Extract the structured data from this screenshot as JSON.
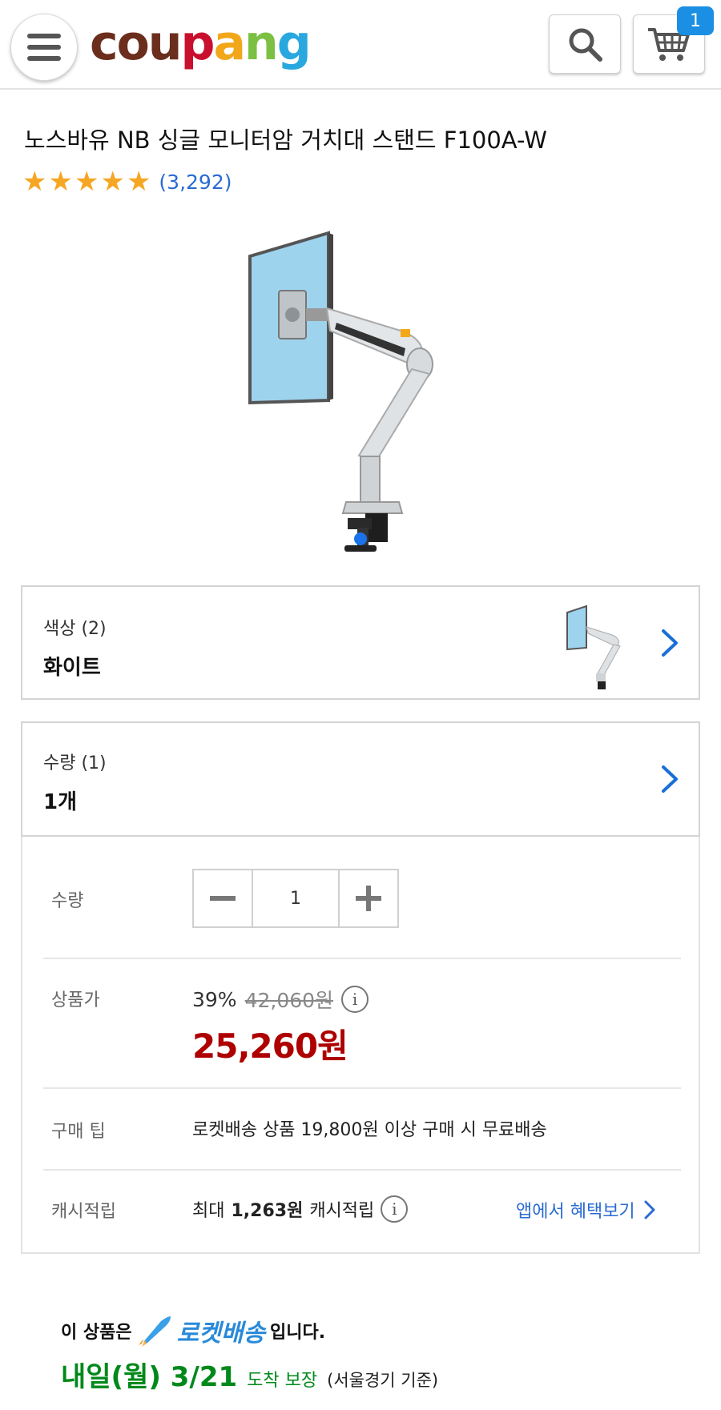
{
  "header": {
    "logo_text": [
      "cou",
      "p",
      "a",
      "n",
      "g"
    ],
    "cart_count": "1"
  },
  "product": {
    "title": "노스바유 NB 싱글 모니터암 거치대 스탠드 F100A-W",
    "rating_stars": 5,
    "review_count": "(3,292)"
  },
  "options": {
    "color_label": "색상 (2)",
    "color_value": "화이트",
    "qty_label": "수량 (1)",
    "qty_value": "1개"
  },
  "detail": {
    "qty_label": "수량",
    "qty_value": "1",
    "price_label": "상품가",
    "discount_rate": "39%",
    "original_price": "42,060원",
    "sale_price": "25,260원",
    "tip_label": "구매 팁",
    "tip_text": "로켓배송 상품 19,800원 이상 구매 시 무료배송",
    "cash_label": "캐시적립",
    "cash_prefix": "최대",
    "cash_amount": "1,263원",
    "cash_suffix": "캐시적립",
    "app_link": "앱에서 혜택보기"
  },
  "delivery": {
    "prefix": "이 상품은",
    "brand": "로켓배송",
    "suffix": "입니다.",
    "date": "내일(월) 3/21",
    "guarantee": "도착 보장",
    "region": "(서울경기 기준)"
  },
  "colors": {
    "accent_blue": "#2a6bd1",
    "sale_red": "#ae0000",
    "delivery_green": "#00891a",
    "star": "#f5a623"
  }
}
